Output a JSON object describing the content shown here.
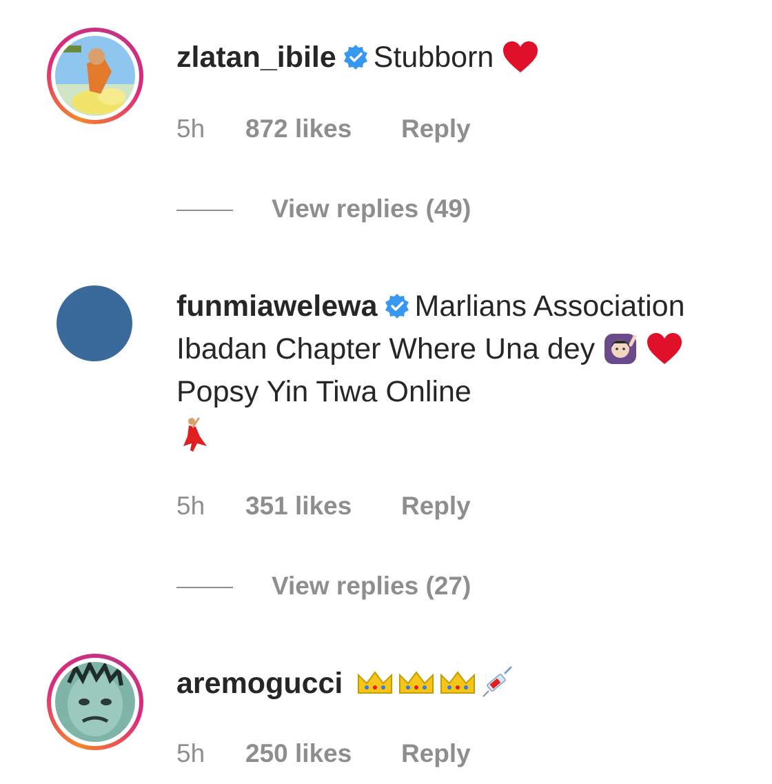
{
  "comments": [
    {
      "username": "zlatan_ibile",
      "verified": true,
      "text": "Stubborn",
      "emoji": [
        "red-heart"
      ],
      "time": "5h",
      "likes": "872 likes",
      "reply_label": "Reply",
      "view_replies": "View replies (49)"
    },
    {
      "username": "funmiawelewa",
      "verified": true,
      "text_part1": "Marlians Association Ibadan Chapter Where Una dey",
      "text_part2": "Popsy Yin Tiwa Online",
      "emoji": [
        "woman-raising-hand",
        "red-heart",
        "woman-dancing"
      ],
      "time": "5h",
      "likes": "351 likes",
      "reply_label": "Reply",
      "view_replies": "View replies (27)"
    },
    {
      "username": "aremogucci",
      "verified": false,
      "emoji": [
        "crown",
        "crown",
        "crown",
        "syringe"
      ],
      "time": "5h",
      "likes": "250 likes",
      "reply_label": "Reply"
    }
  ],
  "colors": {
    "text": "#262626",
    "muted": "#8e8e8e",
    "verified_blue": "#3897f0",
    "heart_red": "#e0102a",
    "avatar_blue": "#3a6a9c"
  }
}
